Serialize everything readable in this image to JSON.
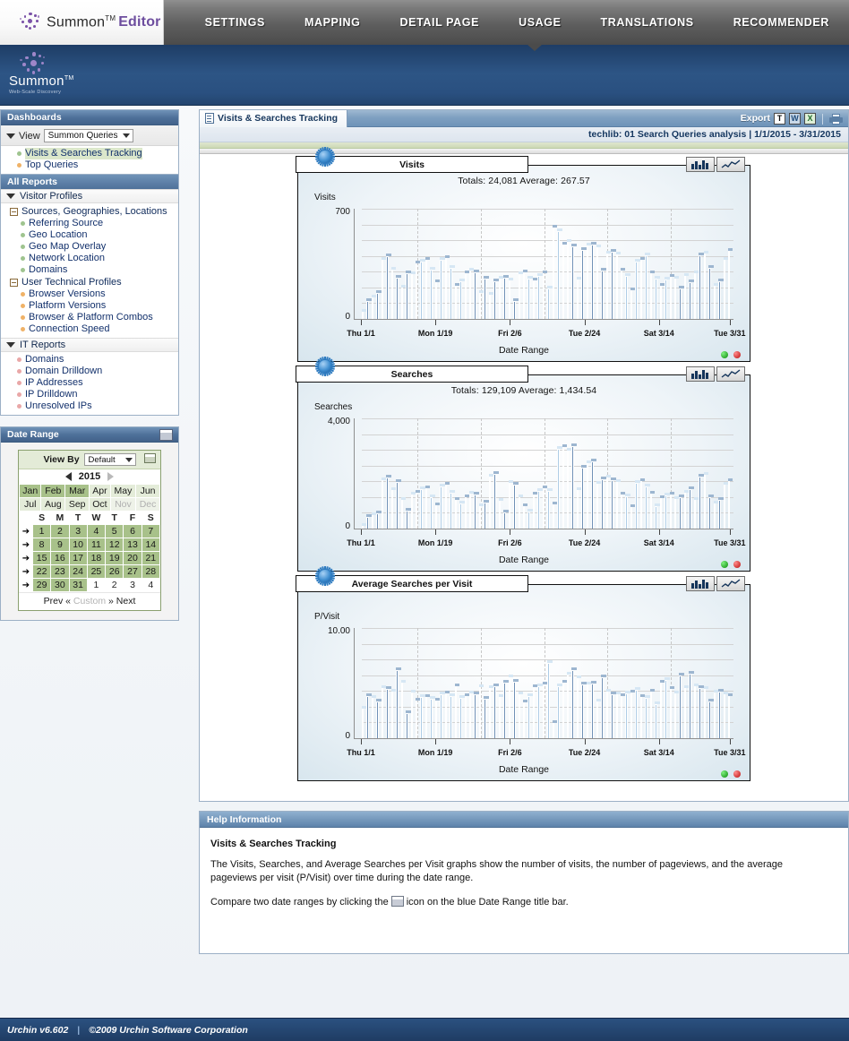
{
  "topbar": {
    "brand_name": "Summon",
    "brand_tm": "TM",
    "brand_suffix": "Editor",
    "tabs": [
      {
        "label": "SETTINGS",
        "active": false
      },
      {
        "label": "MAPPING",
        "active": false
      },
      {
        "label": "DETAIL PAGE",
        "active": false
      },
      {
        "label": "USAGE",
        "active": true
      },
      {
        "label": "TRANSLATIONS",
        "active": false
      },
      {
        "label": "RECOMMENDER",
        "active": false
      }
    ]
  },
  "banner": {
    "logo_name": "Summon",
    "logo_tm": "TM",
    "tagline": "Web-Scale Discovery"
  },
  "sidebar": {
    "dashboards": {
      "title": "Dashboards",
      "view_label": "View",
      "view_value": "Summon Queries",
      "items": [
        {
          "label": "Visits & Searches Tracking",
          "selected": true,
          "color": "#9fc48f"
        },
        {
          "label": "Top Queries",
          "selected": false,
          "color": "#f0b267"
        }
      ]
    },
    "all_reports": {
      "title": "All Reports",
      "groups": [
        {
          "label": "Visitor Profiles",
          "type": "triangle",
          "subgroups": [
            {
              "label": "Sources, Geographies, Locations",
              "items": [
                {
                  "label": "Referring Source",
                  "color": "#9fc48f"
                },
                {
                  "label": "Geo Location",
                  "color": "#9fc48f"
                },
                {
                  "label": "Geo Map Overlay",
                  "color": "#9fc48f"
                },
                {
                  "label": "Network Location",
                  "color": "#9fc48f"
                },
                {
                  "label": "Domains",
                  "color": "#9fc48f"
                }
              ]
            },
            {
              "label": "User Technical Profiles",
              "items": [
                {
                  "label": "Browser Versions",
                  "color": "#f0b267"
                },
                {
                  "label": "Platform Versions",
                  "color": "#f0b267"
                },
                {
                  "label": "Browser & Platform Combos",
                  "color": "#f0b267"
                },
                {
                  "label": "Connection Speed",
                  "color": "#f0b267"
                }
              ]
            }
          ]
        },
        {
          "label": "IT Reports",
          "type": "triangle",
          "items": [
            {
              "label": "Domains",
              "color": "#e9a7a7"
            },
            {
              "label": "Domain Drilldown",
              "color": "#e9a7a7"
            },
            {
              "label": "IP Addresses",
              "color": "#e9a7a7"
            },
            {
              "label": "IP Drilldown",
              "color": "#e9a7a7"
            },
            {
              "label": "Unresolved IPs",
              "color": "#e9a7a7"
            }
          ]
        }
      ]
    },
    "date_range": {
      "title": "Date Range",
      "view_by_label": "View By",
      "view_by_value": "Default",
      "year": "2015",
      "months_row1": [
        {
          "label": "Jan",
          "state": "on"
        },
        {
          "label": "Feb",
          "state": "on"
        },
        {
          "label": "Mar",
          "state": "on"
        },
        {
          "label": "Apr",
          "state": "mid"
        },
        {
          "label": "May",
          "state": "mid"
        },
        {
          "label": "Jun",
          "state": "mid"
        }
      ],
      "months_row2": [
        {
          "label": "Jul",
          "state": "mid"
        },
        {
          "label": "Aug",
          "state": "mid"
        },
        {
          "label": "Sep",
          "state": "mid"
        },
        {
          "label": "Oct",
          "state": "mid"
        },
        {
          "label": "Nov",
          "state": "off"
        },
        {
          "label": "Dec",
          "state": "off"
        }
      ],
      "weekday_headers": [
        "S",
        "M",
        "T",
        "W",
        "T",
        "F",
        "S"
      ],
      "weeks": [
        {
          "arrow": "➔",
          "days": [
            {
              "d": "1",
              "in": true
            },
            {
              "d": "2",
              "in": true
            },
            {
              "d": "3",
              "in": true
            },
            {
              "d": "4",
              "in": true
            },
            {
              "d": "5",
              "in": true
            },
            {
              "d": "6",
              "in": true
            },
            {
              "d": "7",
              "in": true
            }
          ]
        },
        {
          "arrow": "➔",
          "days": [
            {
              "d": "8",
              "in": true
            },
            {
              "d": "9",
              "in": true
            },
            {
              "d": "10",
              "in": true
            },
            {
              "d": "11",
              "in": true
            },
            {
              "d": "12",
              "in": true
            },
            {
              "d": "13",
              "in": true
            },
            {
              "d": "14",
              "in": true
            }
          ]
        },
        {
          "arrow": "➔",
          "days": [
            {
              "d": "15",
              "in": true
            },
            {
              "d": "16",
              "in": true
            },
            {
              "d": "17",
              "in": true
            },
            {
              "d": "18",
              "in": true
            },
            {
              "d": "19",
              "in": true
            },
            {
              "d": "20",
              "in": true
            },
            {
              "d": "21",
              "in": true
            }
          ]
        },
        {
          "arrow": "➔",
          "days": [
            {
              "d": "22",
              "in": true
            },
            {
              "d": "23",
              "in": true
            },
            {
              "d": "24",
              "in": true
            },
            {
              "d": "25",
              "in": true
            },
            {
              "d": "26",
              "in": true
            },
            {
              "d": "27",
              "in": true
            },
            {
              "d": "28",
              "in": true
            }
          ]
        },
        {
          "arrow": "➔",
          "days": [
            {
              "d": "29",
              "in": true
            },
            {
              "d": "30",
              "in": true
            },
            {
              "d": "31",
              "in": true
            },
            {
              "d": "1",
              "in": false
            },
            {
              "d": "2",
              "in": false
            },
            {
              "d": "3",
              "in": false
            },
            {
              "d": "4",
              "in": false
            }
          ]
        }
      ],
      "prev_label": "Prev",
      "custom_label": "Custom",
      "next_label": "Next",
      "prev_chev": "«",
      "next_chev": "»"
    }
  },
  "report": {
    "tab_title": "Visits & Searches Tracking",
    "export_label": "Export",
    "export_icons": [
      "text-export-icon",
      "word-export-icon",
      "excel-export-icon",
      "print-icon"
    ],
    "profile_line": "techlib: 01 Search Queries analysis  |  1/1/2015 - 3/31/2015"
  },
  "help": {
    "title": "Help Information",
    "heading": "Visits & Searches Tracking",
    "paragraph1": "The Visits, Searches, and Average Searches per Visit graphs show the number of visits, the number of pageviews, and the average pageviews per visit (P/Visit) over time during the date range.",
    "paragraph2_pre": "Compare two date ranges by clicking the",
    "paragraph2_post": "icon on the blue Date Range title bar."
  },
  "footer": {
    "version": "Urchin v6.602",
    "sep": "|",
    "copyright": "©2009 Urchin Software Corporation"
  },
  "chart_data": [
    {
      "type": "bar",
      "title": "Visits",
      "totals_line": "Totals: 24,081   Average: 267.57",
      "totals": 24081,
      "average": 267.57,
      "ylabel": "Visits",
      "xlabel": "Date Range",
      "ylim": [
        0,
        700
      ],
      "ymax_label": "700",
      "ymin_label": "0",
      "grid": true,
      "xticks": [
        "Thu 1/1",
        "Mon 1/19",
        "Fri 2/6",
        "Tue 2/24",
        "Sat 3/14",
        "Tue 3/31"
      ],
      "xtick_positions": [
        0,
        20,
        40,
        60,
        80,
        99
      ],
      "values": [
        60,
        130,
        155,
        185,
        390,
        415,
        330,
        280,
        215,
        305,
        300,
        370,
        380,
        395,
        330,
        250,
        395,
        405,
        340,
        230,
        255,
        310,
        325,
        315,
        185,
        275,
        170,
        255,
        275,
        280,
        260,
        130,
        300,
        315,
        275,
        260,
        290,
        305,
        210,
        595,
        575,
        490,
        505,
        480,
        265,
        455,
        485,
        490,
        475,
        325,
        430,
        445,
        425,
        325,
        290,
        200,
        380,
        395,
        420,
        310,
        275,
        230,
        265,
        285,
        275,
        210,
        290,
        250,
        305,
        420,
        435,
        340,
        230,
        255,
        395,
        450
      ]
    },
    {
      "type": "bar",
      "title": "Searches",
      "totals_line": "Totals: 129,109   Average: 1,434.54",
      "totals": 129109,
      "average": 1434.54,
      "ylabel": "Searches",
      "xlabel": "Date Range",
      "ylim": [
        0,
        4000
      ],
      "ymax_label": "4,000",
      "ymin_label": "0",
      "grid": true,
      "xticks": [
        "Thu 1/1",
        "Mon 1/19",
        "Fri 2/6",
        "Tue 2/24",
        "Sat 3/14",
        "Tue 3/31"
      ],
      "xtick_positions": [
        0,
        20,
        40,
        60,
        80,
        99
      ],
      "values": [
        180,
        520,
        600,
        660,
        1850,
        1960,
        1500,
        1800,
        1130,
        760,
        1330,
        1390,
        1520,
        1570,
        1250,
        930,
        1640,
        1700,
        1390,
        1150,
        1000,
        1250,
        1380,
        1320,
        900,
        1040,
        2000,
        2080,
        1110,
        680,
        1750,
        1700,
        1250,
        920,
        700,
        1340,
        1470,
        1550,
        1480,
        960,
        2980,
        3050,
        2940,
        3080,
        1510,
        2310,
        2470,
        2540,
        1720,
        1890,
        1940,
        1870,
        1780,
        1330,
        1260,
        880,
        1760,
        1830,
        1620,
        1380,
        900,
        1220,
        1290,
        1340,
        1180,
        1250,
        1400,
        1520,
        1150,
        2000,
        2050,
        1230,
        1020,
        1150,
        1700,
        1830
      ]
    },
    {
      "type": "bar",
      "title": "Average Searches per Visit",
      "totals_line": "",
      "ylabel": "P/Visit",
      "xlabel": "Date Range",
      "ylim": [
        0,
        10
      ],
      "ymax_label": "10.00",
      "ymin_label": "0",
      "grid": true,
      "xticks": [
        "Thu 1/1",
        "Mon 1/19",
        "Fri 2/6",
        "Tue 2/24",
        "Sat 3/14",
        "Tue 3/31"
      ],
      "xtick_positions": [
        0,
        20,
        40,
        60,
        80,
        99
      ],
      "values": [
        2.9,
        4.1,
        3.9,
        3.6,
        4.8,
        4.7,
        4.5,
        6.4,
        5.3,
        2.5,
        4.4,
        3.7,
        4.0,
        4.0,
        3.8,
        3.7,
        4.2,
        4.3,
        4.1,
        5.0,
        3.9,
        4.1,
        4.3,
        4.2,
        4.9,
        3.8,
        4.8,
        5.0,
        4.0,
        5.3,
        5.8,
        5.4,
        4.2,
        3.5,
        4.1,
        4.9,
        5.0,
        5.1,
        7.1,
        1.6,
        5.0,
        5.3,
        6.0,
        6.4,
        5.7,
        5.1,
        5.1,
        5.2,
        3.6,
        5.8,
        4.5,
        4.2,
        4.2,
        4.1,
        4.3,
        4.4,
        4.6,
        4.0,
        3.9,
        4.5,
        3.3,
        5.3,
        5.5,
        4.7,
        4.3,
        5.9,
        4.8,
        6.1,
        5.0,
        4.8,
        4.7,
        3.6,
        4.4,
        4.5,
        4.2,
        4.1
      ]
    }
  ]
}
